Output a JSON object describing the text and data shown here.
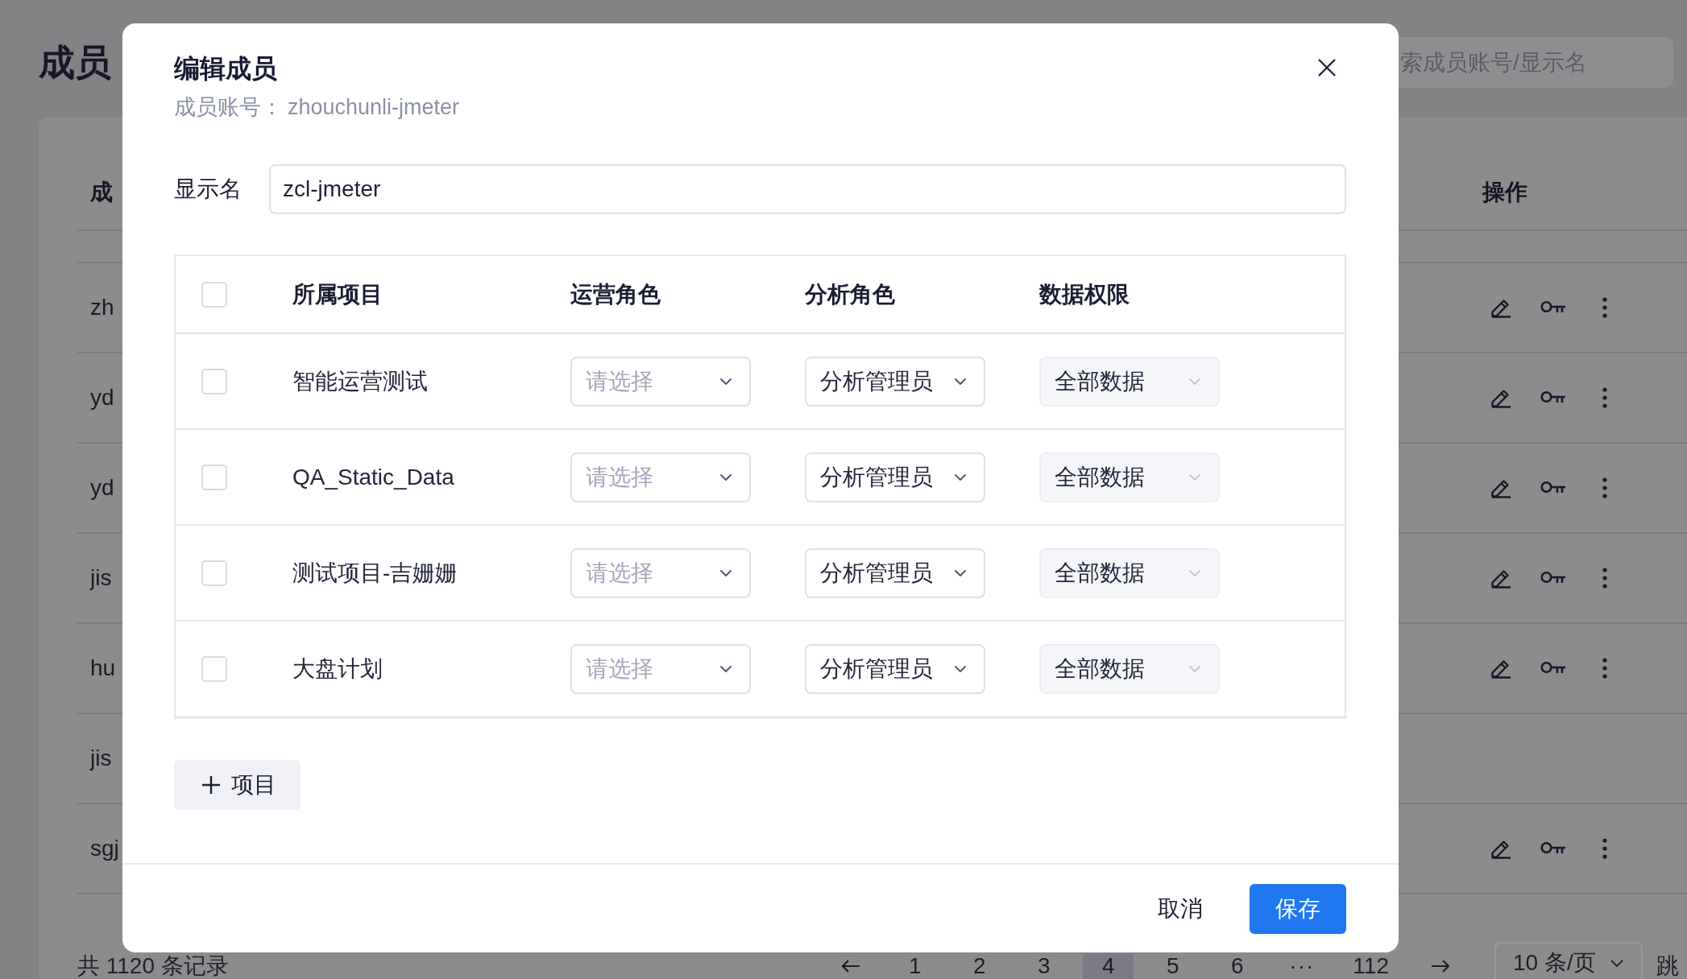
{
  "page": {
    "title": "成员",
    "search": {
      "placeholder": "索成员账号/显示名"
    }
  },
  "member_table": {
    "columns": [
      "成",
      "操作"
    ],
    "rows": [
      {
        "account": "zh",
        "actions": true
      },
      {
        "account": "yd",
        "actions": true
      },
      {
        "account": "yd",
        "actions": true
      },
      {
        "account": "jis",
        "actions": true
      },
      {
        "account": "hu",
        "actions": true
      },
      {
        "account": "jis",
        "actions": false
      },
      {
        "account": "sgj",
        "actions": true
      }
    ]
  },
  "footer": {
    "total": "共 1120 条记录",
    "pagination": {
      "pages": [
        {
          "label": "1",
          "kind": "page",
          "selected": false
        },
        {
          "label": "2",
          "kind": "page",
          "selected": false
        },
        {
          "label": "3",
          "kind": "page",
          "selected": false
        },
        {
          "label": "4",
          "kind": "page",
          "selected": true
        },
        {
          "label": "5",
          "kind": "page",
          "selected": false
        },
        {
          "label": "6",
          "kind": "page",
          "selected": false
        },
        {
          "label": "···",
          "kind": "ellipsis",
          "selected": false
        },
        {
          "label": "112",
          "kind": "page",
          "selected": false
        }
      ],
      "page_size": "10 条/页",
      "jump_label": "跳"
    }
  },
  "dialog": {
    "title": "编辑成员",
    "account_label": "成员账号：",
    "account_value": "zhouchunli-jmeter",
    "display_name": {
      "label": "显示名",
      "value": "zcl-jmeter"
    },
    "project_table": {
      "all_checked": false,
      "columns": [
        "所属项目",
        "运营角色",
        "分析角色",
        "数据权限"
      ],
      "rows": [
        {
          "checked": false,
          "project": "智能运营测试",
          "ops_role": {
            "placeholder": "请选择"
          },
          "analysis_role": {
            "value": "分析管理员"
          },
          "data_scope": {
            "value": "全部数据",
            "disabled": true
          }
        },
        {
          "checked": false,
          "project": "QA_Static_Data",
          "ops_role": {
            "placeholder": "请选择"
          },
          "analysis_role": {
            "value": "分析管理员"
          },
          "data_scope": {
            "value": "全部数据",
            "disabled": true
          }
        },
        {
          "checked": false,
          "project": "测试项目-吉姗姗",
          "ops_role": {
            "placeholder": "请选择"
          },
          "analysis_role": {
            "value": "分析管理员"
          },
          "data_scope": {
            "value": "全部数据",
            "disabled": true
          }
        },
        {
          "checked": false,
          "project": "大盘计划",
          "ops_role": {
            "placeholder": "请选择"
          },
          "analysis_role": {
            "value": "分析管理员"
          },
          "data_scope": {
            "value": "全部数据",
            "disabled": true
          }
        }
      ]
    },
    "add_button": "项目",
    "buttons": [
      {
        "label": "取消",
        "kind": "text"
      },
      {
        "label": "保存",
        "kind": "primary"
      }
    ]
  }
}
